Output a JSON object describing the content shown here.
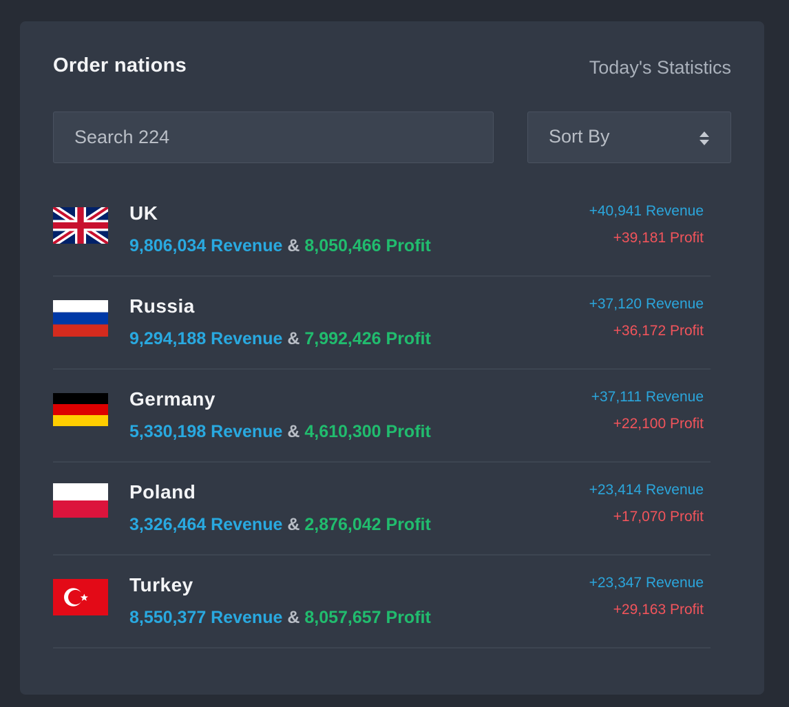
{
  "header": {
    "title": "Order nations",
    "subtitle": "Today's Statistics"
  },
  "search": {
    "placeholder": "Search 224"
  },
  "sort": {
    "label": "Sort By",
    "icon": "sort-arrows-icon"
  },
  "colors": {
    "revenue": "#29a9e0",
    "profit_total": "#21bc6e",
    "profit_delta": "#f2545b"
  },
  "connector": "&",
  "countries": [
    {
      "name": "UK",
      "flag": "uk-flag-icon",
      "revenue": "9,806,034 Revenue",
      "profit": "8,050,466 Profit",
      "revenue_delta": "+40,941 Revenue",
      "profit_delta": "+39,181 Profit"
    },
    {
      "name": "Russia",
      "flag": "russia-flag-icon",
      "revenue": "9,294,188 Revenue",
      "profit": "7,992,426 Profit",
      "revenue_delta": "+37,120 Revenue",
      "profit_delta": "+36,172 Profit"
    },
    {
      "name": "Germany",
      "flag": "germany-flag-icon",
      "revenue": "5,330,198 Revenue",
      "profit": "4,610,300 Profit",
      "revenue_delta": "+37,111 Revenue",
      "profit_delta": "+22,100 Profit"
    },
    {
      "name": "Poland",
      "flag": "poland-flag-icon",
      "revenue": "3,326,464 Revenue",
      "profit": "2,876,042 Profit",
      "revenue_delta": "+23,414 Revenue",
      "profit_delta": "+17,070 Profit"
    },
    {
      "name": "Turkey",
      "flag": "turkey-flag-icon",
      "revenue": "8,550,377 Revenue",
      "profit": "8,057,657 Profit",
      "revenue_delta": "+23,347 Revenue",
      "profit_delta": "+29,163 Profit"
    }
  ]
}
